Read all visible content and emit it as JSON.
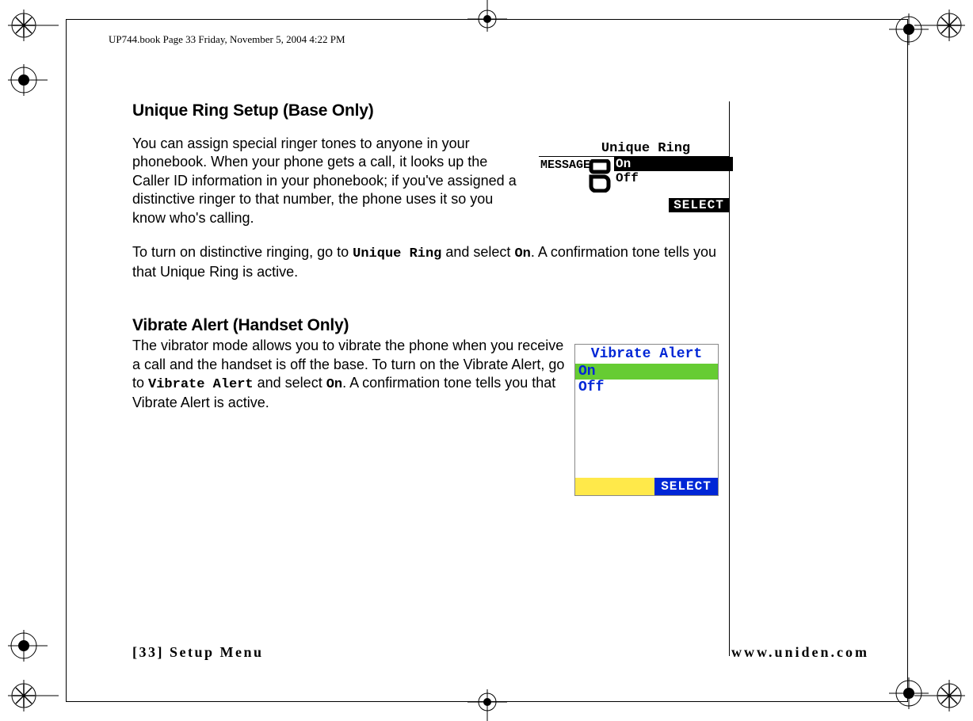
{
  "header": "UP744.book  Page 33  Friday, November 5, 2004  4:22 PM",
  "section1": {
    "heading": "Unique Ring Setup (Base Only)",
    "para1": "You can assign special ringer tones to anyone in your phonebook. When your phone gets a call, it looks up the Caller ID information in your phonebook; if you've assigned a distinctive ringer to that number, the phone uses it so you know who's calling.",
    "para2a": "To turn on distinctive ringing, go to ",
    "para2_k1": "Unique Ring",
    "para2b": " and select ",
    "para2_k2": "On",
    "para2c": ". A confirmation tone tells you that Unique Ring is active."
  },
  "section2": {
    "heading": "Vibrate Alert (Handset Only)",
    "para_a": "The vibrator mode allows you to vibrate the phone when you receive a call and the handset is off the base. To turn on the Vibrate Alert, go to ",
    "para_k1": "Vibrate Alert",
    "para_b": " and select ",
    "para_k2": "On",
    "para_c": ". A confirmation tone tells you that Vibrate Alert is active."
  },
  "lcd1": {
    "title": "Unique Ring",
    "message_label": "MESSAGE",
    "option_on": "On",
    "option_off": "Off",
    "softkey": "SELECT"
  },
  "lcd2": {
    "title": "Vibrate Alert",
    "option_on": "On",
    "option_off": "Off",
    "softkey": "SELECT"
  },
  "footer": {
    "left": "[33] Setup Menu",
    "right": "www.uniden.com"
  }
}
